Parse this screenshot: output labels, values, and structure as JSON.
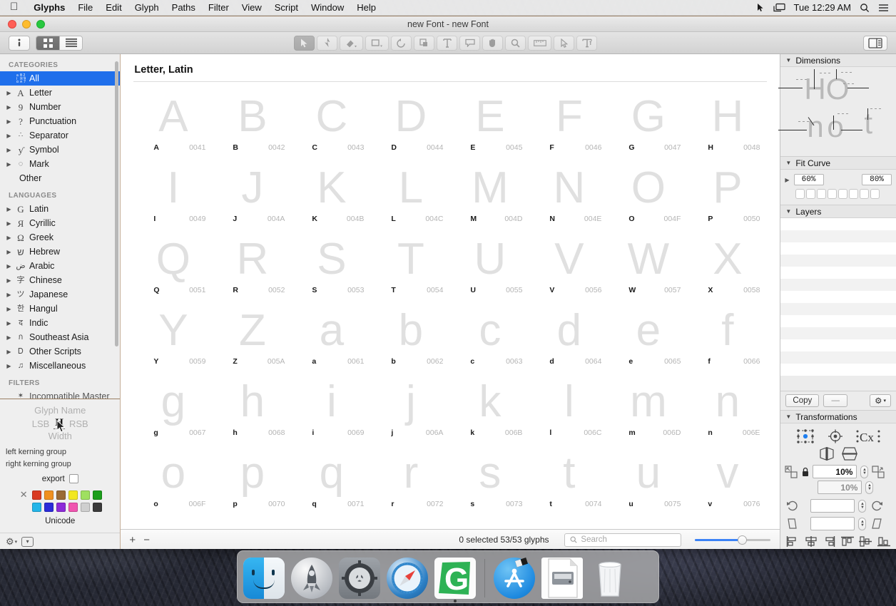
{
  "menubar": {
    "apple_icon": "apple-logo",
    "items": [
      "Glyphs",
      "File",
      "Edit",
      "Glyph",
      "Paths",
      "Filter",
      "View",
      "Script",
      "Window",
      "Help"
    ],
    "status_icons": [
      "cursor-icon",
      "display-icon"
    ],
    "clock": "Tue 12:29 AM",
    "search_icon": "search-icon",
    "list_icon": "control-center-icon"
  },
  "window": {
    "title": "new Font - new Font",
    "traffic_lights": [
      "close-button",
      "minimize-button",
      "zoom-button"
    ]
  },
  "toolbar": {
    "info_icon": "info-icon",
    "view_grid_icon": "grid-view-icon",
    "view_list_icon": "list-view-icon",
    "tools": [
      {
        "name": "select-tool",
        "glyph": "➤"
      },
      {
        "name": "draw-pen-tool",
        "glyph": "✒"
      },
      {
        "name": "eraser-tool",
        "glyph": "◆"
      },
      {
        "name": "shape-tool",
        "glyph": "□"
      },
      {
        "name": "rotate-tool",
        "glyph": "↺"
      },
      {
        "name": "scale-tool",
        "glyph": "⧉"
      },
      {
        "name": "text-tool",
        "glyph": "T"
      },
      {
        "name": "annotation-tool",
        "glyph": "▭"
      },
      {
        "name": "hand-tool",
        "glyph": "✋"
      },
      {
        "name": "zoom-tool",
        "glyph": "⌕"
      },
      {
        "name": "measurement-tool",
        "glyph": "▤"
      },
      {
        "name": "knife-tool",
        "glyph": "➤"
      },
      {
        "name": "text-preview-tool",
        "glyph": "T̲"
      }
    ],
    "inspector_toggle_icon": "panel-toggle-icon"
  },
  "sidebar": {
    "categories_header": "CATEGORIES",
    "categories": [
      {
        "label": "All",
        "icon": "all-glyphs-icon",
        "selected": true,
        "expandable": false
      },
      {
        "label": "Letter",
        "icon": "A",
        "selected": false,
        "expandable": true
      },
      {
        "label": "Number",
        "icon": "9",
        "selected": false,
        "expandable": true
      },
      {
        "label": "Punctuation",
        "icon": "?",
        "selected": false,
        "expandable": true
      },
      {
        "label": "Separator",
        "icon": "∴",
        "selected": false,
        "expandable": true
      },
      {
        "label": "Symbol",
        "icon": "ƴ",
        "selected": false,
        "expandable": true
      },
      {
        "label": "Mark",
        "icon": "◌",
        "selected": false,
        "expandable": true
      },
      {
        "label": "Other",
        "icon": "",
        "selected": false,
        "expandable": false
      }
    ],
    "languages_header": "LANGUAGES",
    "languages": [
      {
        "label": "Latin",
        "icon": "G"
      },
      {
        "label": "Cyrillic",
        "icon": "Я"
      },
      {
        "label": "Greek",
        "icon": "Ω"
      },
      {
        "label": "Hebrew",
        "icon": "ש"
      },
      {
        "label": "Arabic",
        "icon": "ض"
      },
      {
        "label": "Chinese",
        "icon": "字"
      },
      {
        "label": "Japanese",
        "icon": "ツ"
      },
      {
        "label": "Hangul",
        "icon": "한"
      },
      {
        "label": "Indic",
        "icon": "द"
      },
      {
        "label": "Southeast Asia",
        "icon": "ก"
      },
      {
        "label": "Other Scripts",
        "icon": "Ꭰ"
      },
      {
        "label": "Miscellaneous",
        "icon": "♫"
      }
    ],
    "filters_header": "FILTERS",
    "filters": [
      {
        "label": "Incompatible Master",
        "icon": "star-icon"
      }
    ]
  },
  "inspector": {
    "glyph_name_placeholder": "Glyph Name",
    "lsb_label": "LSB",
    "rsb_label": "RSB",
    "sample_glyph": "H",
    "width_label": "Width",
    "left_kerning_group": "left kerning group",
    "right_kerning_group": "right kerning group",
    "export_label": "export",
    "export_checked": false,
    "colors_row1": [
      "#d93a22",
      "#f0901f",
      "#9a6a34",
      "#f2e721",
      "#9fe060",
      "#1c9e1c"
    ],
    "colors_row2": [
      "#23b5e8",
      "#2b2bd8",
      "#8d2bd8",
      "#f055b0",
      "#cfcfcf",
      "#3b3b3b"
    ],
    "no_color_icon": "clear-color-icon",
    "unicode_label": "Unicode",
    "gear_icon": "gear-icon",
    "add_icon": "dropdown-box-icon"
  },
  "main": {
    "section_title": "Letter, Latin",
    "glyphs": [
      {
        "char": "A",
        "name": "A",
        "unicode": "0041"
      },
      {
        "char": "B",
        "name": "B",
        "unicode": "0042"
      },
      {
        "char": "C",
        "name": "C",
        "unicode": "0043"
      },
      {
        "char": "D",
        "name": "D",
        "unicode": "0044"
      },
      {
        "char": "E",
        "name": "E",
        "unicode": "0045"
      },
      {
        "char": "F",
        "name": "F",
        "unicode": "0046"
      },
      {
        "char": "G",
        "name": "G",
        "unicode": "0047"
      },
      {
        "char": "H",
        "name": "H",
        "unicode": "0048"
      },
      {
        "char": "I",
        "name": "I",
        "unicode": "0049"
      },
      {
        "char": "J",
        "name": "J",
        "unicode": "004A"
      },
      {
        "char": "K",
        "name": "K",
        "unicode": "004B"
      },
      {
        "char": "L",
        "name": "L",
        "unicode": "004C"
      },
      {
        "char": "M",
        "name": "M",
        "unicode": "004D"
      },
      {
        "char": "N",
        "name": "N",
        "unicode": "004E"
      },
      {
        "char": "O",
        "name": "O",
        "unicode": "004F"
      },
      {
        "char": "P",
        "name": "P",
        "unicode": "0050"
      },
      {
        "char": "Q",
        "name": "Q",
        "unicode": "0051"
      },
      {
        "char": "R",
        "name": "R",
        "unicode": "0052"
      },
      {
        "char": "S",
        "name": "S",
        "unicode": "0053"
      },
      {
        "char": "T",
        "name": "T",
        "unicode": "0054"
      },
      {
        "char": "U",
        "name": "U",
        "unicode": "0055"
      },
      {
        "char": "V",
        "name": "V",
        "unicode": "0056"
      },
      {
        "char": "W",
        "name": "W",
        "unicode": "0057"
      },
      {
        "char": "X",
        "name": "X",
        "unicode": "0058"
      },
      {
        "char": "Y",
        "name": "Y",
        "unicode": "0059"
      },
      {
        "char": "Z",
        "name": "Z",
        "unicode": "005A"
      },
      {
        "char": "a",
        "name": "a",
        "unicode": "0061"
      },
      {
        "char": "b",
        "name": "b",
        "unicode": "0062"
      },
      {
        "char": "c",
        "name": "c",
        "unicode": "0063"
      },
      {
        "char": "d",
        "name": "d",
        "unicode": "0064"
      },
      {
        "char": "e",
        "name": "e",
        "unicode": "0065"
      },
      {
        "char": "f",
        "name": "f",
        "unicode": "0066"
      },
      {
        "char": "g",
        "name": "g",
        "unicode": "0067"
      },
      {
        "char": "h",
        "name": "h",
        "unicode": "0068"
      },
      {
        "char": "i",
        "name": "i",
        "unicode": "0069"
      },
      {
        "char": "j",
        "name": "j",
        "unicode": "006A"
      },
      {
        "char": "k",
        "name": "k",
        "unicode": "006B"
      },
      {
        "char": "l",
        "name": "l",
        "unicode": "006C"
      },
      {
        "char": "m",
        "name": "m",
        "unicode": "006D"
      },
      {
        "char": "n",
        "name": "n",
        "unicode": "006E"
      },
      {
        "char": "o",
        "name": "o",
        "unicode": "006F"
      },
      {
        "char": "p",
        "name": "p",
        "unicode": "0070"
      },
      {
        "char": "q",
        "name": "q",
        "unicode": "0071"
      },
      {
        "char": "r",
        "name": "r",
        "unicode": "0072"
      },
      {
        "char": "s",
        "name": "s",
        "unicode": "0073"
      },
      {
        "char": "t",
        "name": "t",
        "unicode": "0074"
      },
      {
        "char": "u",
        "name": "u",
        "unicode": "0075"
      },
      {
        "char": "v",
        "name": "v",
        "unicode": "0076"
      }
    ]
  },
  "statusbar": {
    "add_label": "+",
    "remove_label": "−",
    "count_text": "0 selected 53/53 glyphs",
    "search_placeholder": "Search",
    "search_icon": "search-icon",
    "zoom_value": 62
  },
  "rightpanel": {
    "dimensions": {
      "title": "Dimensions",
      "sample_upper": "HO",
      "sample_lower_n": "n",
      "sample_lower_o": "o",
      "sample_lower_t": "t"
    },
    "fit_curve": {
      "title": "Fit Curve",
      "value_left": "60%",
      "value_right": "80%",
      "cell_count": 8
    },
    "layers": {
      "title": "Layers",
      "row_count": 13
    },
    "actions": {
      "copy_label": "Copy",
      "dash_label": "—",
      "gear_icon": "gear-icon"
    },
    "transformations": {
      "title": "Transformations",
      "origin_icon": "transform-origin-icon",
      "center_icon": "transform-center-icon",
      "metrics_icon": "transform-metrics-icon",
      "flip_horizontal_icon": "flip-horizontal-icon",
      "flip_vertical_icon": "flip-vertical-icon",
      "scale_down_icon": "scale-down-icon",
      "scale_up_icon": "scale-up-icon",
      "lock_icon": "lock-icon",
      "scale_x": "10%",
      "scale_y": "10%",
      "rotate_ccw_icon": "rotate-ccw-icon",
      "rotate_cw_icon": "rotate-cw-icon",
      "rotate_value": "",
      "slant_left_icon": "slant-left-icon",
      "slant_right_icon": "slant-right-icon",
      "slant_value": "",
      "align_icons": [
        "align-left-icon",
        "align-center-h-icon",
        "align-right-icon",
        "align-top-icon",
        "align-center-v-icon",
        "align-bottom-icon"
      ]
    }
  },
  "dock": {
    "items": [
      {
        "name": "finder",
        "running": true
      },
      {
        "name": "launchpad",
        "running": false
      },
      {
        "name": "system-preferences",
        "running": false
      },
      {
        "name": "safari",
        "running": false
      },
      {
        "name": "glyphs",
        "running": true
      }
    ],
    "items_right": [
      {
        "name": "app-store",
        "running": false
      },
      {
        "name": "disk-image",
        "running": false
      },
      {
        "name": "trash",
        "running": false
      }
    ]
  }
}
